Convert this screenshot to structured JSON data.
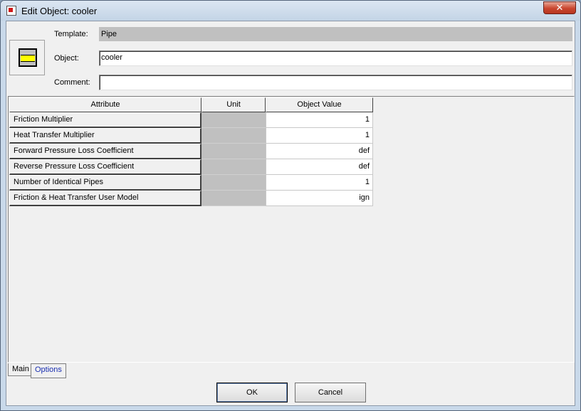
{
  "window": {
    "title": "Edit Object: cooler",
    "close_label": "✕"
  },
  "form": {
    "template_label": "Template:",
    "template_value": "Pipe",
    "object_label": "Object:",
    "object_value": "cooler",
    "comment_label": "Comment:",
    "comment_value": ""
  },
  "table": {
    "headers": [
      "Attribute",
      "Unit",
      "Object Value"
    ],
    "rows": [
      {
        "attribute": "Friction Multiplier",
        "unit": "",
        "value": "1"
      },
      {
        "attribute": "Heat Transfer Multiplier",
        "unit": "",
        "value": "1"
      },
      {
        "attribute": "Forward Pressure Loss Coefficient",
        "unit": "",
        "value": "def"
      },
      {
        "attribute": "Reverse Pressure Loss Coefficient",
        "unit": "",
        "value": "def"
      },
      {
        "attribute": "Number of Identical Pipes",
        "unit": "",
        "value": "1"
      },
      {
        "attribute": "Friction & Heat Transfer User Model",
        "unit": "",
        "value": "ign"
      }
    ]
  },
  "tabs": [
    "Main",
    "Options"
  ],
  "buttons": {
    "ok": "OK",
    "cancel": "Cancel"
  },
  "icons": {
    "app": "app-icon",
    "object": "pipe-object-icon",
    "close": "close-icon"
  }
}
